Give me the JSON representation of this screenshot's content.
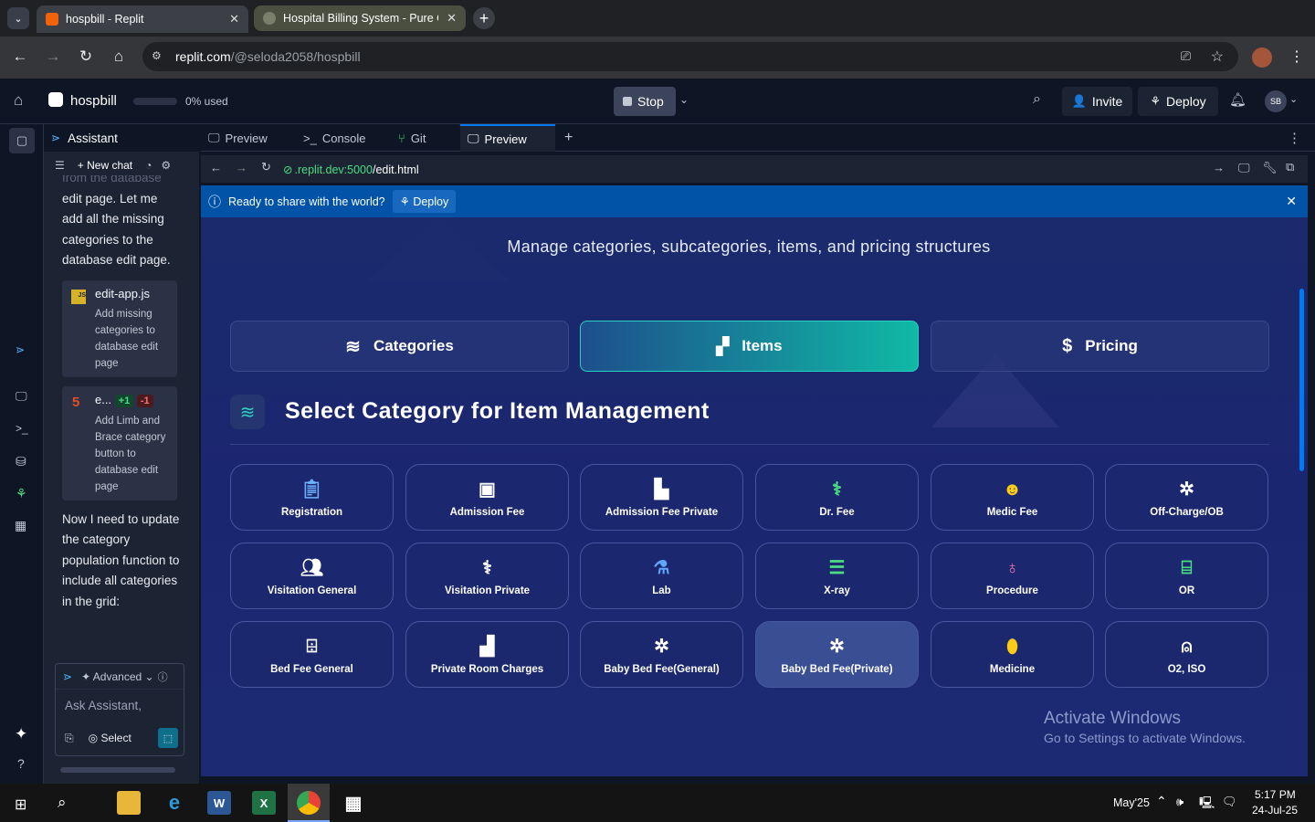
{
  "browser": {
    "tabs": [
      {
        "title": "hospbill - Replit"
      },
      {
        "title": "Hospital Billing System - Pure C"
      }
    ],
    "url_host": "replit.com",
    "url_path": "/@seloda2058/hospbill"
  },
  "replit_top": {
    "project": "hospbill",
    "usage": "0% used",
    "stop_label": "Stop",
    "invite_label": "Invite",
    "deploy_label": "Deploy",
    "avatar": "SB"
  },
  "assistant": {
    "title": "Assistant",
    "new_chat": "New chat",
    "partial_top": "from the database",
    "message1": "edit page. Let me add all the missing categories to the database edit page.",
    "file1_name": "edit-app.js",
    "file1_badge": "JS",
    "file1_desc": "Add missing categories to database edit page",
    "file2_name": "e...",
    "file2_add": "+1",
    "file2_del": "-1",
    "file2_desc": "Add Limb and Brace category button to database edit page",
    "message2": "Now I need to update the category population function to include all categories in the grid:",
    "advanced": "Advanced",
    "input_placeholder": "Ask Assistant,",
    "select_label": "Select"
  },
  "pane_tabs": [
    {
      "label": "Preview"
    },
    {
      "label": "Console"
    },
    {
      "label": "Git"
    },
    {
      "label": "Preview"
    }
  ],
  "preview_bar": {
    "url_host": ".replit.dev:5000",
    "url_path": "/edit.html"
  },
  "banner": {
    "text": "Ready to share with the world?",
    "button": "Deploy"
  },
  "page": {
    "subtitle": "Manage categories, subcategories, items, and pricing structures",
    "segments": [
      {
        "label": "Categories",
        "icon": "layers-icon"
      },
      {
        "label": "Items",
        "icon": "boxes-icon"
      },
      {
        "label": "Pricing",
        "icon": "dollar-icon"
      }
    ],
    "section_title": "Select Category for Item Management",
    "categories": [
      {
        "label": "Registration",
        "icon": "clipboard-icon",
        "color": "#6fb1ff"
      },
      {
        "label": "Admission Fee",
        "icon": "hospital-user-icon",
        "color": "#ffffff"
      },
      {
        "label": "Admission Fee Private",
        "icon": "hospital-icon",
        "color": "#ffffff"
      },
      {
        "label": "Dr. Fee",
        "icon": "doctor-icon",
        "color": "#4ade80"
      },
      {
        "label": "Medic Fee",
        "icon": "nurse-icon",
        "color": "#facc15"
      },
      {
        "label": "Off-Charge/OB",
        "icon": "baby-icon",
        "color": "#ffffff"
      },
      {
        "label": "Visitation General",
        "icon": "users-icon",
        "color": "#ffffff"
      },
      {
        "label": "Visitation Private",
        "icon": "doctor-icon",
        "color": "#ffffff"
      },
      {
        "label": "Lab",
        "icon": "flask-icon",
        "color": "#60a5fa"
      },
      {
        "label": "X-ray",
        "icon": "xray-icon",
        "color": "#4ade80"
      },
      {
        "label": "Procedure",
        "icon": "stethoscope-icon",
        "color": "#f472b6"
      },
      {
        "label": "OR",
        "icon": "procedures-icon",
        "color": "#4ade80"
      },
      {
        "label": "Bed Fee General",
        "icon": "bed-icon",
        "color": "#ffffff"
      },
      {
        "label": "Private Room Charges",
        "icon": "building-icon",
        "color": "#ffffff"
      },
      {
        "label": "Baby Bed Fee(General)",
        "icon": "baby-icon",
        "color": "#ffffff"
      },
      {
        "label": "Baby Bed Fee(Private)",
        "icon": "baby-icon",
        "color": "#ffffff"
      },
      {
        "label": "Medicine",
        "icon": "pills-icon",
        "color": "#facc15"
      },
      {
        "label": "O2, ISO",
        "icon": "lungs-icon",
        "color": "#ffffff"
      }
    ]
  },
  "watermark": {
    "line1": "Activate Windows",
    "line2": "Go to Settings to activate Windows."
  },
  "taskbar": {
    "period": "May'25",
    "time": "5:17 PM",
    "date": "24-Jul-25"
  }
}
